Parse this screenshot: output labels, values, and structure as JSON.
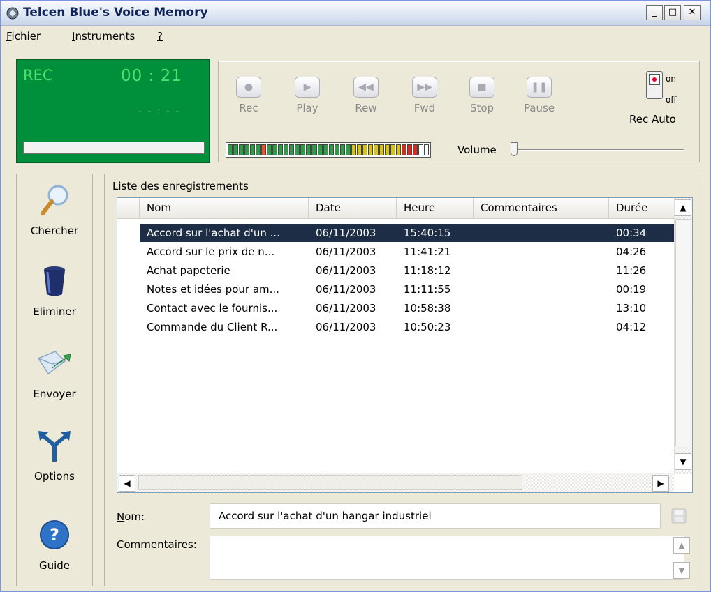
{
  "window": {
    "title": "Telcen Blue's Voice Memory"
  },
  "menu": [
    {
      "accel": "F",
      "rest": "ichier"
    },
    {
      "accel": "I",
      "rest": "nstruments"
    },
    {
      "accel": "?",
      "rest": ""
    }
  ],
  "display": {
    "mode": "REC",
    "time": "00 : 21",
    "sub": "- - : - -"
  },
  "transport": {
    "rec": "Rec",
    "play": "Play",
    "rew": "Rew",
    "fwd": "Fwd",
    "stop": "Stop",
    "pause": "Pause"
  },
  "volume": {
    "label": "Volume"
  },
  "rec_auto": {
    "on": "on",
    "off": "off",
    "label": "Rec Auto"
  },
  "sidebar": {
    "search": "Chercher",
    "delete": "Eliminer",
    "send": "Envoyer",
    "options": "Options",
    "guide": "Guide"
  },
  "list": {
    "caption": "Liste des enregistrements",
    "columns": {
      "name": "Nom",
      "date": "Date",
      "time": "Heure",
      "comments": "Commentaires",
      "duration": "Durée"
    },
    "rows": [
      {
        "name": "Accord sur l'achat d'un ...",
        "date": "06/11/2003",
        "time": "15:40:15",
        "comment": "",
        "duration": "00:34"
      },
      {
        "name": "Accord sur le prix de n...",
        "date": "06/11/2003",
        "time": "11:41:21",
        "comment": "",
        "duration": "04:26"
      },
      {
        "name": "Achat papeterie",
        "date": "06/11/2003",
        "time": "11:18:12",
        "comment": "",
        "duration": "11:26"
      },
      {
        "name": "Notes et idées pour am...",
        "date": "06/11/2003",
        "time": "11:11:55",
        "comment": "",
        "duration": "00:19"
      },
      {
        "name": "Contact avec le fournis...",
        "date": "06/11/2003",
        "time": "10:58:38",
        "comment": "",
        "duration": "13:10"
      },
      {
        "name": "Commande du Client R...",
        "date": "06/11/2003",
        "time": "10:50:23",
        "comment": "",
        "duration": "04:12"
      }
    ]
  },
  "form": {
    "name_accel": "N",
    "name_rest": "om:",
    "name_value": "Accord sur l'achat d'un hangar industriel",
    "comments_pre": "Co",
    "comments_accel": "m",
    "comments_rest": "mentaires:",
    "comments_value": ""
  }
}
